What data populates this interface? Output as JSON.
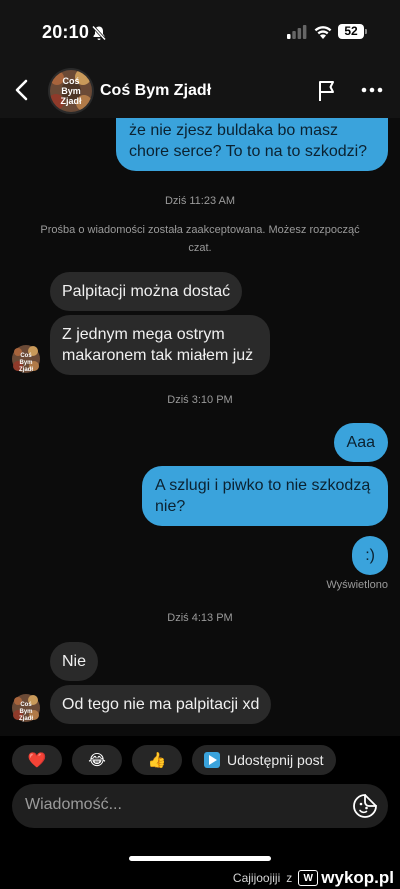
{
  "status_bar": {
    "time": "20:10",
    "battery": "52",
    "icons": [
      "bell-slash-icon",
      "signal-icon",
      "wifi-icon",
      "battery-icon"
    ]
  },
  "header": {
    "title": "Coś Bym Zjadł",
    "avatar_text": [
      "Coś",
      "Bym",
      "Zjadł"
    ],
    "icons": [
      "back-icon",
      "flag-icon",
      "more-icon"
    ]
  },
  "messages": {
    "out_top": "nejto. Bo nie rozumiem. Mówisz że nie zjesz buldaka bo masz chore serce? To to na to szkodzi?",
    "ts1": "Dziś 11:23 AM",
    "system_note": "Prośba o wiadomości została zaakceptowana. Możesz rozpocząć czat.",
    "in1": "Palpitacji można dostać",
    "in2": "Z jednym mega ostrym makaronem tak miałem już",
    "ts2": "Dziś 3:10 PM",
    "out1": "Aaa",
    "out2": "A szlugi i piwko to nie szkodzą nie?",
    "out3": ":)",
    "seen": "Wyświetlono",
    "ts3": "Dziś 4:13 PM",
    "in3": "Nie",
    "in4": "Od tego nie ma palpitacji xd"
  },
  "reactions": {
    "heart": "❤️",
    "laugh": "😂",
    "thumbs": "👍",
    "share_label": "Udostępnij post"
  },
  "composer": {
    "placeholder": "Wiadomość..."
  },
  "watermark": {
    "user": "Cajijoojiji",
    "sep": "z",
    "site": "wykop.pl"
  },
  "colors": {
    "outgoing_bubble": "#3aa3dc",
    "incoming_bubble": "#2a2a2a",
    "background": "#0c0c0c"
  }
}
